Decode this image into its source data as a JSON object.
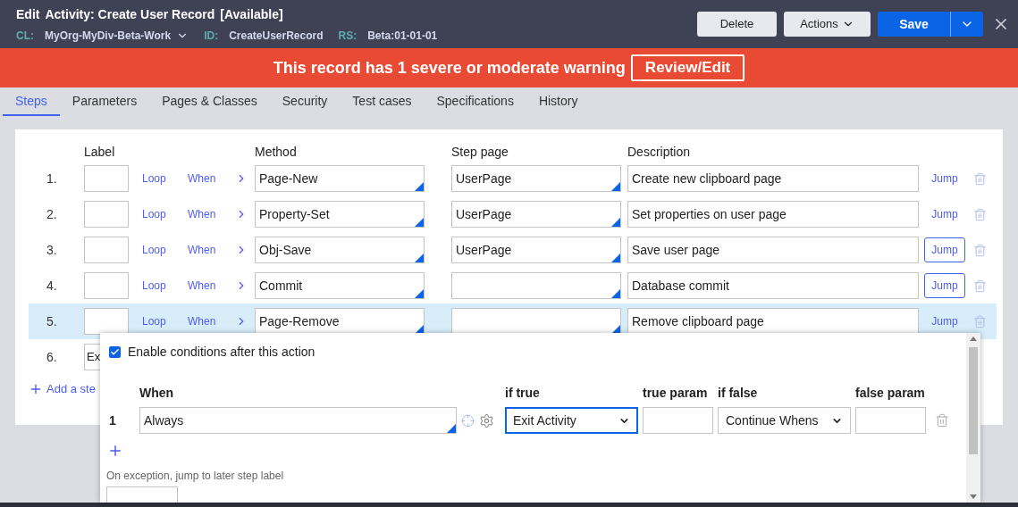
{
  "header": {
    "edit": "Edit",
    "title": "Activity: Create User Record",
    "status": "[Available]",
    "meta": [
      {
        "key": "CL:",
        "value": "MyOrg-MyDiv-Beta-Work",
        "dropdown": true
      },
      {
        "key": "ID:",
        "value": "CreateUserRecord",
        "dropdown": false
      },
      {
        "key": "RS:",
        "value": "Beta:01-01-01",
        "dropdown": false
      }
    ],
    "buttons": [
      {
        "label": "Delete",
        "kind": "plain"
      },
      {
        "label": "Actions",
        "kind": "menu"
      },
      {
        "label": "Save",
        "kind": "split"
      }
    ]
  },
  "warning": {
    "message": "This record has 1 severe or moderate warning",
    "action": "Review/Edit"
  },
  "tabs": [
    {
      "label": "Steps",
      "selected": true
    },
    {
      "label": "Parameters",
      "selected": false
    },
    {
      "label": "Pages & Classes",
      "selected": false
    },
    {
      "label": "Security",
      "selected": false
    },
    {
      "label": "Test cases",
      "selected": false
    },
    {
      "label": "Specifications",
      "selected": false
    },
    {
      "label": "History",
      "selected": false
    }
  ],
  "steps": {
    "columns": {
      "label": "Label",
      "method": "Method",
      "step_page": "Step page",
      "description": "Description"
    },
    "rows": [
      {
        "number": "1.",
        "loop": "Loop",
        "when": "When",
        "method": "Page-New",
        "step_page": "UserPage",
        "description": "Create new clipboard page",
        "jump": "Jump",
        "jump_outlined": false,
        "selected": false
      },
      {
        "number": "2.",
        "loop": "Loop",
        "when": "When",
        "method": "Property-Set",
        "step_page": "UserPage",
        "description": "Set properties on user page",
        "jump": "Jump",
        "jump_outlined": false,
        "selected": false
      },
      {
        "number": "3.",
        "loop": "Loop",
        "when": "When",
        "method": "Obj-Save",
        "step_page": "UserPage",
        "description": "Save user page",
        "jump": "Jump",
        "jump_outlined": true,
        "selected": false
      },
      {
        "number": "4.",
        "loop": "Loop",
        "when": "When",
        "method": "Commit",
        "description": "Database commit",
        "jump": "Jump",
        "jump_outlined": true,
        "selected": false
      },
      {
        "number": "5.",
        "loop": "Loop",
        "when": "When",
        "method": "Page-Remove",
        "description": "Remove clipboard page",
        "jump": "Jump",
        "jump_outlined": false,
        "selected": true
      }
    ],
    "partial_row": {
      "number": "6.",
      "label": "Ex"
    },
    "add_step": "Add a ste"
  },
  "popover": {
    "enable": {
      "label": "Enable conditions after this action",
      "checked": true
    },
    "columns": {
      "when": "When",
      "if_true": "if true",
      "true_param": "true param",
      "if_false": "if false",
      "false_param": "false param"
    },
    "conditions": [
      {
        "number": "1",
        "when": "Always",
        "if_true": "Exit Activity",
        "if_false": "Continue Whens"
      }
    ],
    "exception_label": "On exception, jump to later step label"
  }
}
